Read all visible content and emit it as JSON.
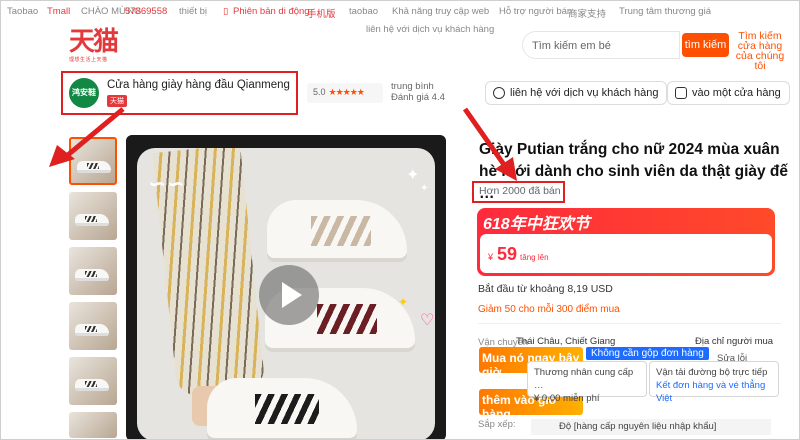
{
  "topnav": {
    "items": [
      "Taobao",
      "Tmall",
      "CHÀO MỪNG",
      "57869558",
      "thiết bị",
      "Phiên bản di động",
      "手机版",
      "taobao",
      "Khả năng truy cập web",
      "Hỗ trợ người bán",
      "商家支持",
      "Trung tâm thương giá"
    ],
    "subnav": [
      "liên hệ với dịch vụ khách hàng"
    ]
  },
  "logo": {
    "text": "天猫",
    "tagline": "理想生活上天猫"
  },
  "search": {
    "placeholder": "Tìm kiếm em bé",
    "button": "tìm kiếm",
    "button2": "Tìm kiếm cửa hàng của chúng tôi"
  },
  "shop": {
    "logo_text": "鸿安鞋",
    "name": "Cửa hàng giày hàng đầu Qianmeng",
    "tag": "天猫",
    "rating_value": "5.0",
    "rating_label": "trung bình",
    "rating_sub": "Đánh giá 4.4",
    "contact_button": "liên hệ với dịch vụ khách hàng",
    "enter_button": "vào một cửa hàng"
  },
  "product": {
    "title": "Giày Putian trắng cho nữ 2024 mùa xuân hè mới dành cho sinh viên da thật giày đế …",
    "sold": "Hơn 2000 đã bán",
    "promo_title": "618年中狂欢节",
    "price_currency": "¥",
    "price": "59",
    "price_suffix": "tăng lên",
    "usd": "Bắt đầu từ khoảng 8,19 USD",
    "coupon": "Giảm 50 cho mỗi 300 điểm mua"
  },
  "shipping": {
    "label": "Vận chuyển",
    "from": "Thái Châu, Chiết Giang",
    "to": "Địa chỉ người mua",
    "buy_now": "Mua nó ngay bây giờ",
    "add_cart": "thêm vào giỏ hàng",
    "blue_tag": "Không cần gộp đơn hàng",
    "card1_line1": "Thương nhân cung cấp …",
    "card1_line2": "¥ 0,00 miễn phí",
    "card2_line1": "Vận tải đường bộ trực tiếp",
    "card2_line2": "Kết đơn hàng và vé thẳng Việt",
    "line_sua": "Sửa lỗi",
    "sort_label": "Sắp xếp:",
    "bottom_text": "Độ [hàng cấp nguyên liệu nhập khẩu]"
  },
  "thumbnails": [
    {
      "selected": true
    },
    {
      "selected": false
    },
    {
      "selected": false
    },
    {
      "selected": false
    },
    {
      "selected": false
    },
    {
      "selected": false
    }
  ],
  "colors": {
    "accent": "#ff5000",
    "tmall_red": "#e4393c",
    "annotation_red": "#e02020",
    "blue": "#1d6bff"
  }
}
